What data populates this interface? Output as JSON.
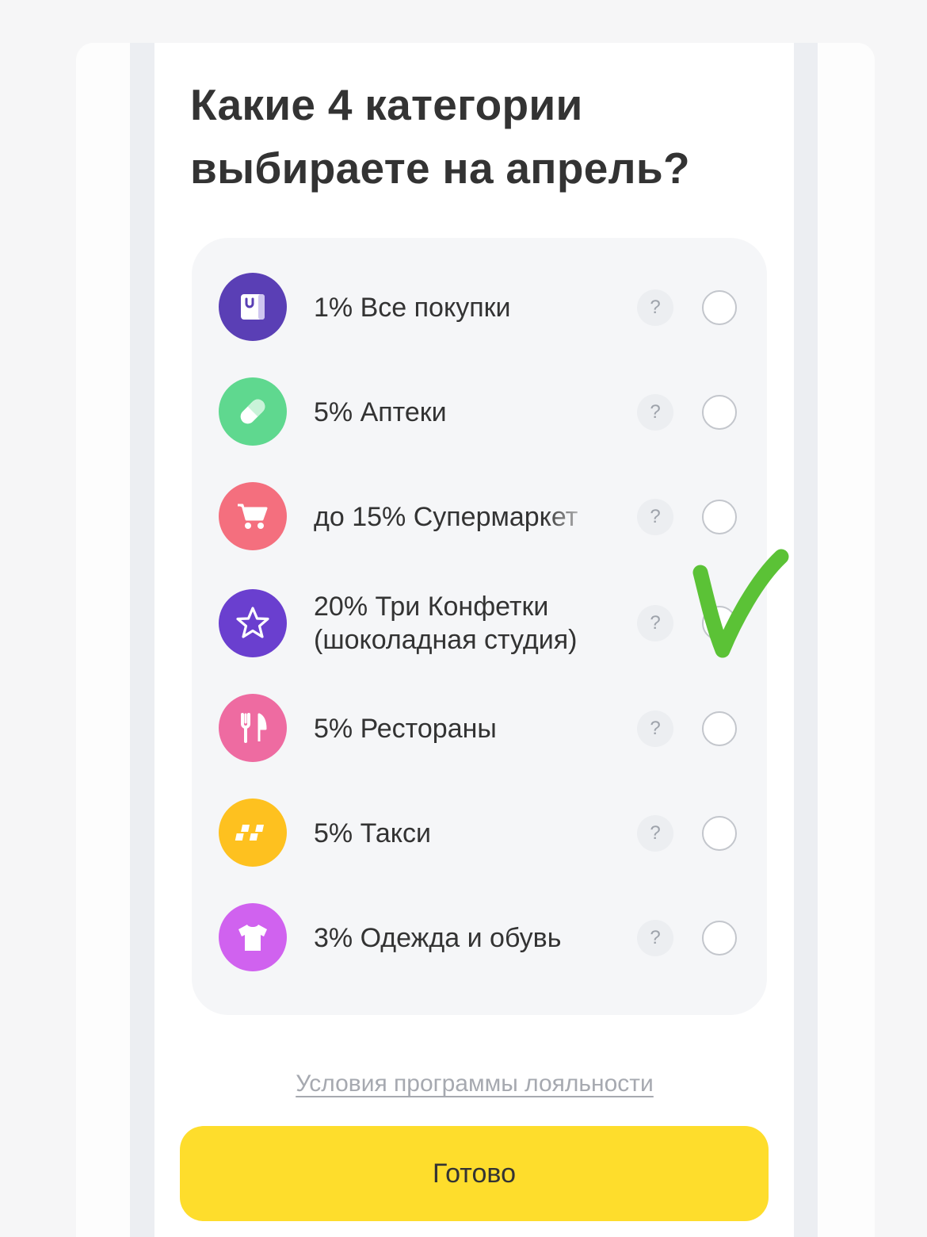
{
  "title": {
    "line1": "Какие 4 категории",
    "line2": "выбираете на апрель?"
  },
  "categories": [
    {
      "label": "1% Все покупки",
      "icon": "shopping-bag-icon",
      "color": "#5a3fb5",
      "selected": false
    },
    {
      "label": "5% Аптеки",
      "icon": "pill-icon",
      "color": "#5fd88f",
      "selected": false
    },
    {
      "label": "до 15% Супермаркет",
      "icon": "shopping-cart-icon",
      "color": "#f46f7e",
      "selected": false
    },
    {
      "label": "20% Три Конфетки",
      "label_line2": "(шоколадная студия)",
      "icon": "star-icon",
      "color": "#6a3fcf",
      "selected": false
    },
    {
      "label": "5% Рестораны",
      "icon": "fork-knife-icon",
      "color": "#ee6ba1",
      "selected": false
    },
    {
      "label": "5% Такси",
      "icon": "taxi-checker-icon",
      "color": "#fec11f",
      "selected": false
    },
    {
      "label": "3% Одежда и обувь",
      "icon": "tshirt-icon",
      "color": "#d062ef",
      "selected": false
    }
  ],
  "help_symbol": "?",
  "footer": {
    "terms_link": "Условия программы лояльности",
    "done_button": "Готово"
  },
  "colors": {
    "accent_yellow": "#fedd2c",
    "check_mark_green": "#5bc236"
  }
}
